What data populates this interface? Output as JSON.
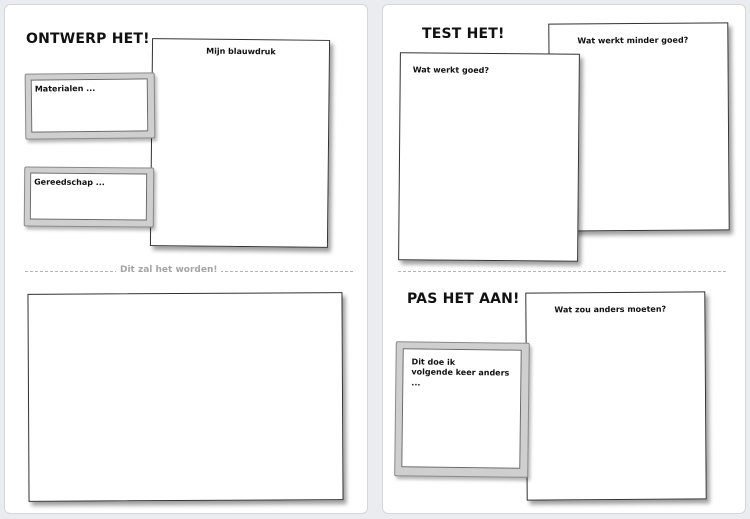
{
  "left": {
    "design_heading": "ONTWERP HET!",
    "blueprint_label": "Mijn blauwdruk",
    "materials_label": "Materialen ...",
    "tools_label": "Gereedschap ...",
    "result_divider": "Dit zal het worden!"
  },
  "right": {
    "test_heading": "TEST HET!",
    "works_less_label": "Wat werkt minder goed?",
    "works_well_label": "Wat werkt goed?",
    "adjust_heading": "PAS HET AAN!",
    "do_differently_label": "Wat zou anders moeten?",
    "next_time_label": "Dit doe ik\nvolgende keer anders ..."
  }
}
